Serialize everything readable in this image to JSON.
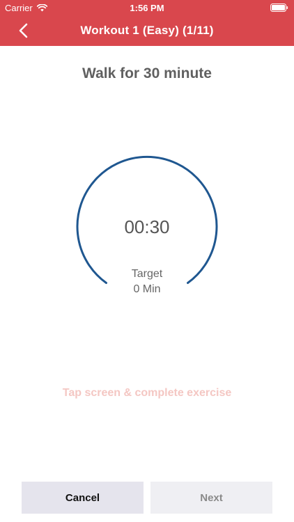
{
  "status_bar": {
    "carrier": "Carrier",
    "time": "1:56 PM"
  },
  "nav": {
    "title": "Workout 1 (Easy) (1/11)"
  },
  "exercise": {
    "title": "Walk for 30 minute",
    "timer": "00:30",
    "target_label": "Target",
    "target_value": "0 Min"
  },
  "hint": "Tap screen & complete exercise",
  "buttons": {
    "cancel": "Cancel",
    "next": "Next"
  },
  "colors": {
    "header": "#d9474d",
    "ring": "#1f5790",
    "hint": "#f4c7c3"
  },
  "icons": {
    "wifi": "wifi-icon",
    "battery": "battery-icon",
    "back": "chevron-left-icon"
  }
}
